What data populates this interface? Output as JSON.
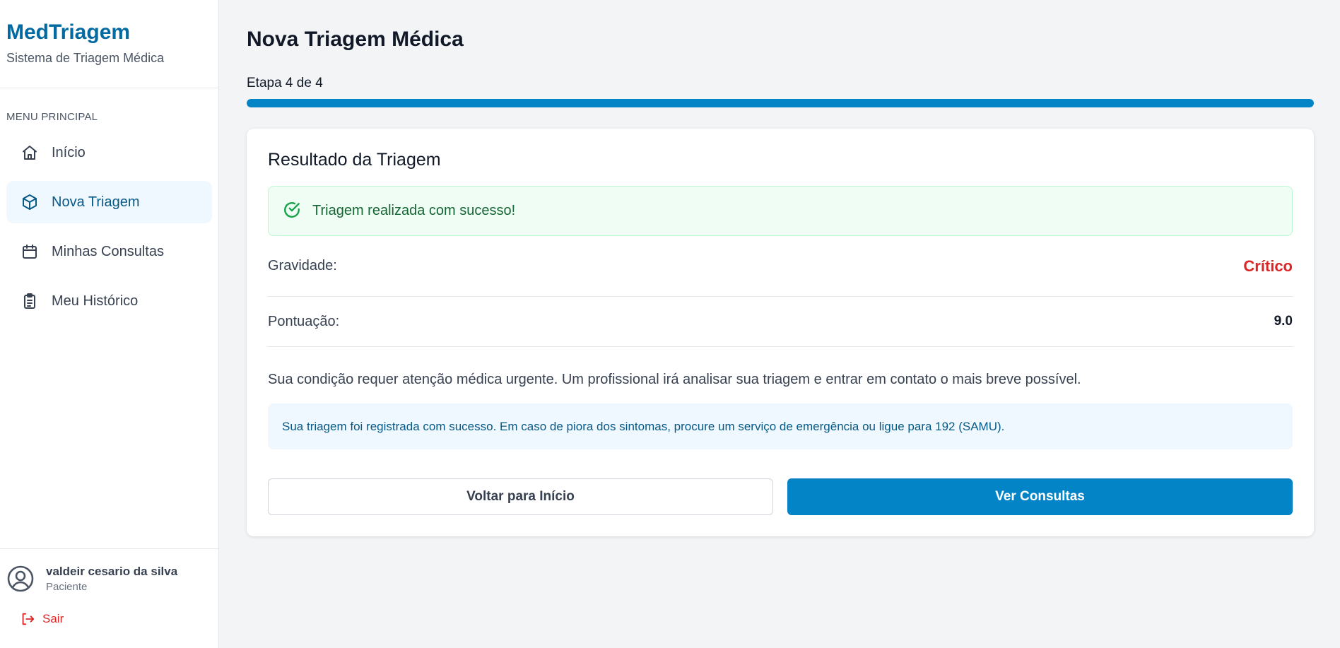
{
  "brand": {
    "title": "MedTriagem",
    "subtitle": "Sistema de Triagem Médica"
  },
  "sidebar": {
    "menu_label": "MENU PRINCIPAL",
    "items": [
      {
        "label": "Início",
        "icon": "home-icon",
        "active": false
      },
      {
        "label": "Nova Triagem",
        "icon": "cube-icon",
        "active": true
      },
      {
        "label": "Minhas Consultas",
        "icon": "calendar-icon",
        "active": false
      },
      {
        "label": "Meu Histórico",
        "icon": "clipboard-icon",
        "active": false
      }
    ],
    "user": {
      "name": "valdeir cesario da silva",
      "role": "Paciente"
    },
    "logout_label": "Sair"
  },
  "main": {
    "page_title": "Nova Triagem Médica",
    "step_label": "Etapa 4 de 4",
    "progress_fraction": 1.0,
    "card": {
      "title": "Resultado da Triagem",
      "success_message": "Triagem realizada com sucesso!",
      "severity_label": "Gravidade:",
      "severity_value": "Crítico",
      "score_label": "Pontuação:",
      "score_value": "9.0",
      "message": "Sua condição requer atenção médica urgente. Um profissional irá analisar sua triagem e entrar em contato o mais breve possível.",
      "info": "Sua triagem foi registrada com sucesso. Em caso de piora dos sintomas, procure um serviço de emergência ou ligue para 192 (SAMU).",
      "back_button": "Voltar para Início",
      "consults_button": "Ver Consultas"
    }
  },
  "colors": {
    "brand": "#0369a1",
    "primary": "#0284c7",
    "critical": "#dc2626",
    "success_bg": "#effdf4",
    "info_bg": "#f0f8ff"
  }
}
